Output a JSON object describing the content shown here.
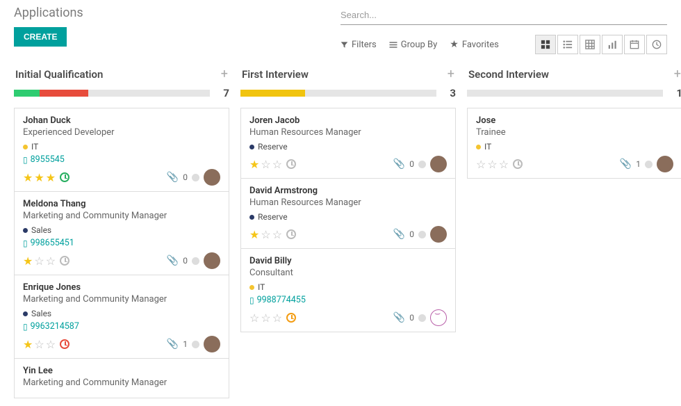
{
  "page": {
    "title": "Applications",
    "create": "CREATE"
  },
  "search": {
    "placeholder": "Search..."
  },
  "filters": {
    "filters": "Filters",
    "group_by": "Group By",
    "favorites": "Favorites"
  },
  "columns": [
    {
      "title": "Initial Qualification",
      "count": "7",
      "segments": [
        {
          "color": "#2ecc71",
          "width": 13
        },
        {
          "color": "#e74c3c",
          "width": 25
        }
      ],
      "cards": [
        {
          "name": "Johan Duck",
          "job": "Experienced Developer",
          "tag": "IT",
          "tag_color": "yellow",
          "phone": "8955545",
          "stars": 3,
          "clock": "green",
          "attachments": "0",
          "avatar": "brown"
        },
        {
          "name": "Meldona Thang",
          "job": "Marketing and Community Manager",
          "tag": "Sales",
          "tag_color": "navy",
          "phone": "998655451",
          "stars": 1,
          "clock": "gray",
          "attachments": "0",
          "avatar": "brown"
        },
        {
          "name": "Enrique Jones",
          "job": "Marketing and Community Manager",
          "tag": "Sales",
          "tag_color": "navy",
          "phone": "9963214587",
          "stars": 1,
          "clock": "red",
          "attachments": "1",
          "avatar": "brown"
        },
        {
          "name": "Yin Lee",
          "job": "Marketing and Community Manager"
        }
      ]
    },
    {
      "title": "First Interview",
      "count": "3",
      "segments": [
        {
          "color": "#f1c40f",
          "width": 33
        }
      ],
      "cards": [
        {
          "name": "Joren Jacob",
          "job": "Human Resources Manager",
          "tag": "Reserve",
          "tag_color": "navy",
          "stars": 1,
          "clock": "gray",
          "attachments": "0",
          "avatar": "brown"
        },
        {
          "name": "David Armstrong",
          "job": "Human Resources Manager",
          "tag": "Reserve",
          "tag_color": "navy",
          "stars": 1,
          "clock": "gray",
          "attachments": "0",
          "avatar": "brown"
        },
        {
          "name": "David Billy",
          "job": "Consultant",
          "tag": "IT",
          "tag_color": "yellow",
          "phone": "9988774455",
          "stars": 0,
          "clock": "orange",
          "attachments": "0",
          "avatar": "smile"
        }
      ]
    },
    {
      "title": "Second Interview",
      "count": "1",
      "segments": [],
      "cards": [
        {
          "name": "Jose",
          "job": "Trainee",
          "tag": "IT",
          "tag_color": "yellow",
          "stars": 0,
          "clock": "gray",
          "attachments": "1",
          "avatar": "brown"
        }
      ]
    }
  ]
}
